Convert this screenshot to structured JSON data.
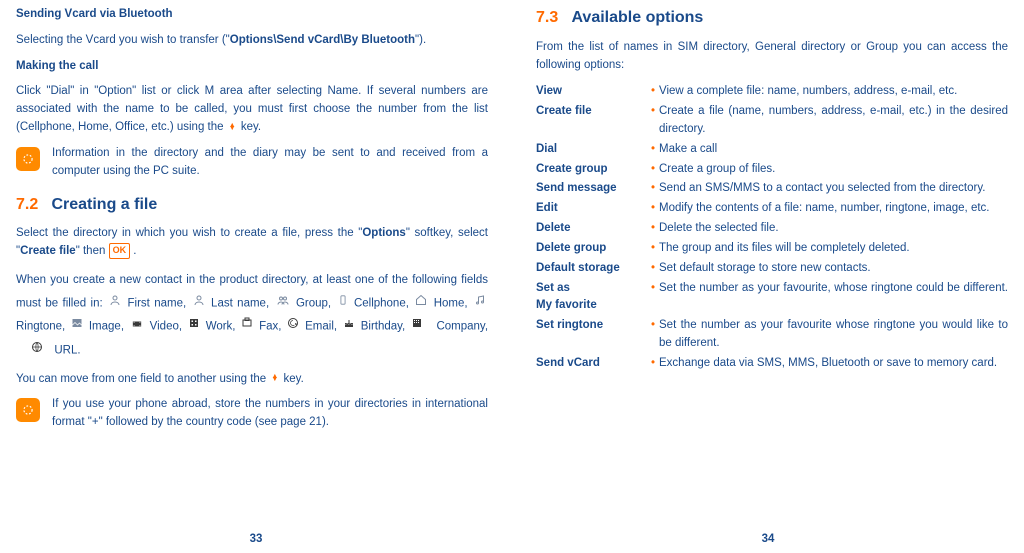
{
  "left": {
    "h1": "Sending Vcard via Bluetooth",
    "p1a": "Selecting the Vcard you wish to transfer (\"",
    "p1b": "Options\\Send vCard\\By Bluetooth",
    "p1c": "\").",
    "h2": "Making the call",
    "p2": "Click \"Dial\" in \"Option\" list or click M area after selecting Name. If several numbers are associated with the name to be called, you must first choose the number from the list (Cellphone, Home, Office, etc.) using the",
    "p2b": "key.",
    "tip1": "Information in the directory and the diary may be sent to and received from a computer using the PC suite.",
    "sec_num": "7.2",
    "sec_title": "Creating a file",
    "p3a": "Select the directory in which you wish to create a file, press the \"",
    "p3b": "Options",
    "p3c": "\" softkey, select \"",
    "p3d": "Create file",
    "p3e": "\" then",
    "p4a": "When you create a new contact in the product directory, at least one of the following fields must be filled in:",
    "f_first": "First name,",
    "f_last": "Last name,",
    "f_group": "Group,",
    "f_cell": "Cellphone,",
    "f_home": "Home,",
    "f_ring": "Ringtone,",
    "f_image": "Image,",
    "f_video": "Video,",
    "f_work": "Work,",
    "f_fax": "Fax,",
    "f_email": "Email,",
    "f_bday": "Birthday,",
    "f_company": "Company,",
    "f_url": "URL.",
    "p5a": "You can move from one field to another using the",
    "p5b": "key.",
    "tip2": "If you use your phone abroad, store the numbers in your directories in international format \"+\" followed by the country code (see page 21).",
    "pgnum": "33"
  },
  "right": {
    "sec_num": "7.3",
    "sec_title": "Available options",
    "intro": "From the list of names in SIM directory, General directory or Group you can access the following options:",
    "options": {
      "view_n": "View",
      "view_d": "View a complete file: name, numbers, address, e-mail, etc.",
      "cfile_n": "Create file",
      "cfile_d": "Create a file (name, numbers, address, e-mail, etc.) in the desired directory.",
      "dial_n": "Dial",
      "dial_d": "Make a call",
      "cgroup_n": "Create group",
      "cgroup_d": "Create a group of files.",
      "smsg_n": "Send message",
      "smsg_d": "Send an SMS/MMS to a contact you selected from the directory.",
      "edit_n": "Edit",
      "edit_d": "Modify the contents of a file: name, number, ringtone, image, etc.",
      "del_n": "Delete",
      "del_d": "Delete the selected file.",
      "dgrp_n": "Delete group",
      "dgrp_d": "The group and its files will be completely deleted.",
      "dstor_n": "Default storage",
      "dstor_d": "Set default storage to store new contacts.",
      "fav_n1": "Set as",
      "fav_n2": "My favorite",
      "fav_d": "Set the number as your favourite, whose ringtone could be different.",
      "ring_n": "Set ringtone",
      "ring_d": "Set the number as your favourite whose ringtone you would like to be different.",
      "vcard_n": "Send vCard",
      "vcard_d": "Exchange data via SMS, MMS, Bluetooth or save to memory card."
    },
    "pgnum": "34"
  }
}
